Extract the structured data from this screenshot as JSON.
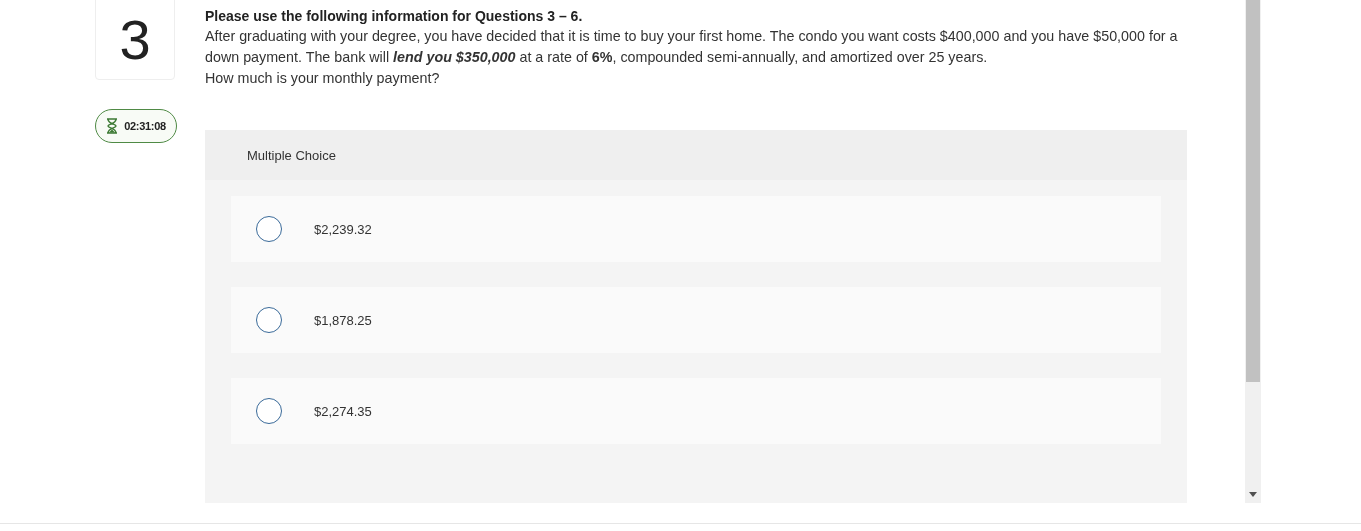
{
  "question_number": "3",
  "timer": "02:31:08",
  "question": {
    "heading": "Please use the following information for Questions 3 – 6.",
    "body": "After graduating with your degree, you have decided that it is time to buy your first home.  The condo you want costs $400,000 and you have $50,000 for a down payment.  The bank will **lend you $350,000** at a rate of **6%**, compounded semi-annually, and amortized over 25 years.",
    "prompt": "How much is your monthly payment?"
  },
  "answer_type": "Multiple Choice",
  "options": [
    {
      "label": "$2,239.32",
      "selected": false
    },
    {
      "label": "$1,878.25",
      "selected": false
    },
    {
      "label": "$2,274.35",
      "selected": false
    }
  ]
}
